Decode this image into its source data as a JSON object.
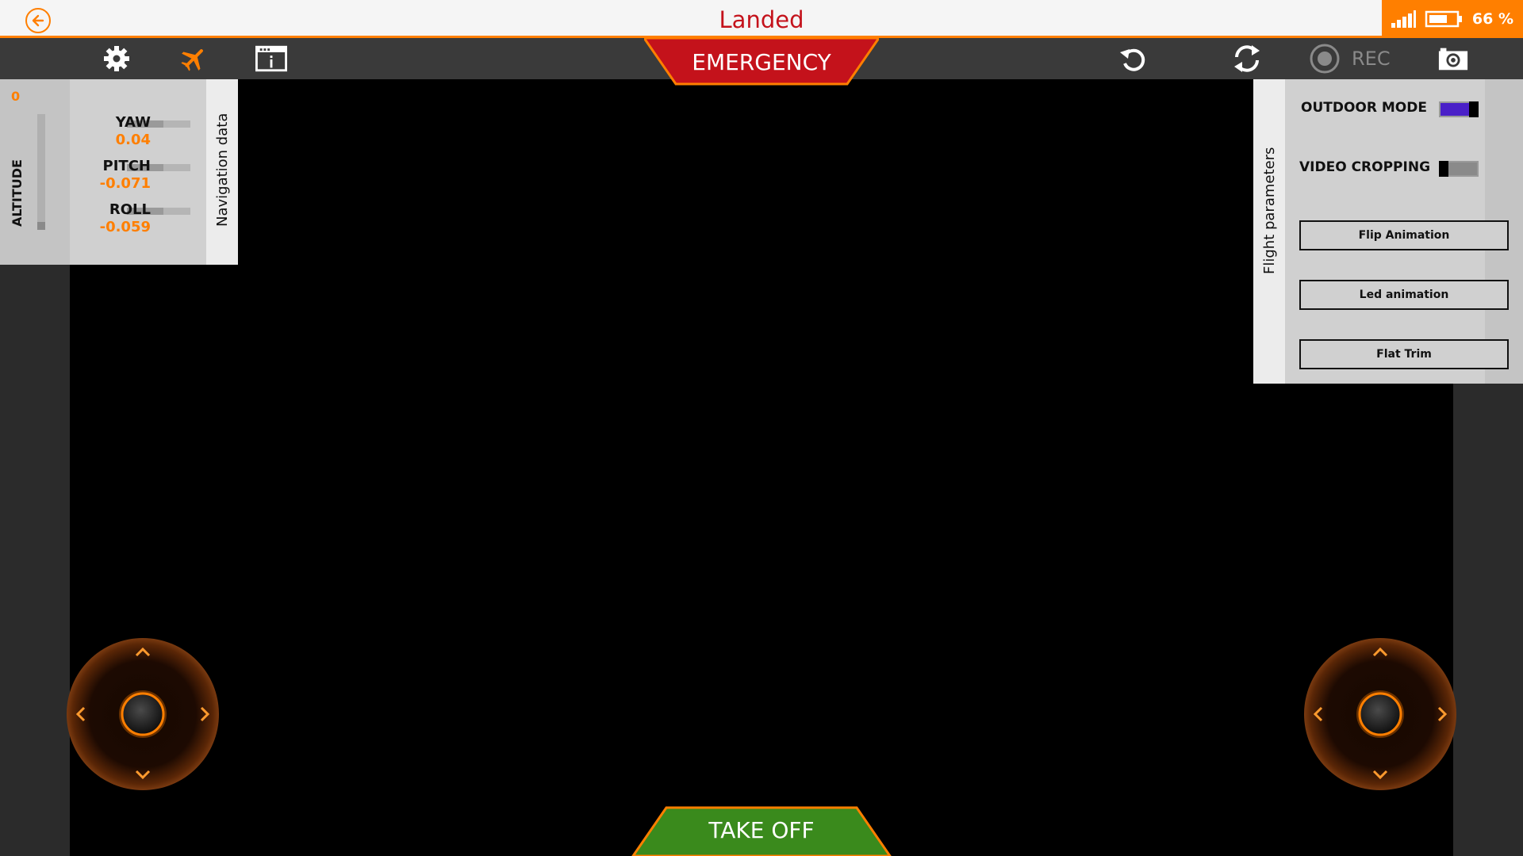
{
  "title_bar": {
    "status": "Landed",
    "battery_percent": "66 %"
  },
  "toolbar": {
    "emergency_label": "EMERGENCY",
    "rec_label": "REC"
  },
  "nav_panel": {
    "tab_label": "Navigation data",
    "altitude_label": "ALTITUDE",
    "altitude_value": "0",
    "metrics": [
      {
        "label": "YAW",
        "value": "0.04"
      },
      {
        "label": "PITCH",
        "value": "-0.071"
      },
      {
        "label": "ROLL",
        "value": "-0.059"
      }
    ]
  },
  "flight_params": {
    "tab_label": "Flight parameters",
    "outdoor_mode_label": "OUTDOOR MODE",
    "outdoor_mode_on": true,
    "video_cropping_label": "VIDEO CROPPING",
    "video_cropping_on": false,
    "buttons": [
      "Flip Animation",
      "Led animation",
      "Flat Trim"
    ]
  },
  "takeoff_label": "TAKE OFF",
  "colors": {
    "accent": "#ff7f00",
    "emergency": "#c4121b",
    "takeoff": "#3a8a1c",
    "toolbar": "#3a3a3a"
  },
  "icons": [
    "back-arrow-icon",
    "gear-icon",
    "airplane-icon",
    "info-window-icon",
    "rotate-icon",
    "sync-icon",
    "record-icon",
    "camera-icon",
    "signal-icon",
    "battery-icon"
  ]
}
